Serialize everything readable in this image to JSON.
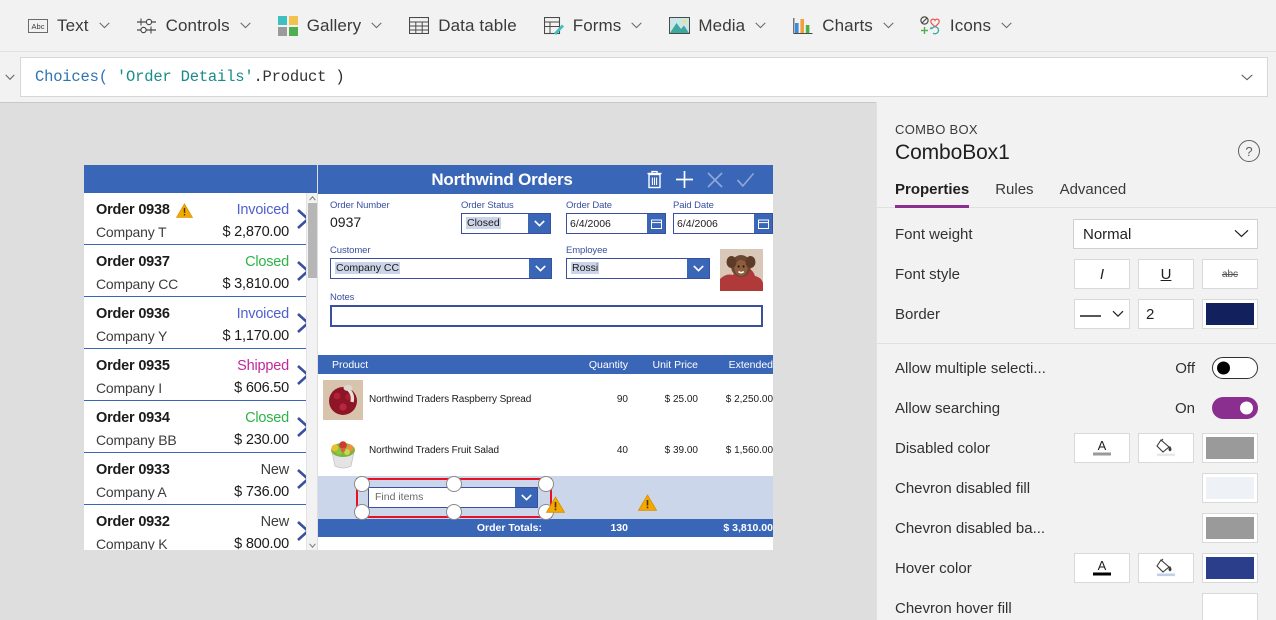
{
  "ribbon": {
    "items": [
      {
        "label": "Text",
        "icon": "text-abc-icon",
        "chevron": true
      },
      {
        "label": "Controls",
        "icon": "controls-sliders-icon",
        "chevron": true
      },
      {
        "label": "Gallery",
        "icon": "gallery-grid-icon",
        "chevron": true
      },
      {
        "label": "Data table",
        "icon": "data-table-icon",
        "chevron": false
      },
      {
        "label": "Forms",
        "icon": "forms-icon",
        "chevron": true
      },
      {
        "label": "Media",
        "icon": "media-image-icon",
        "chevron": true
      },
      {
        "label": "Charts",
        "icon": "charts-bar-icon",
        "chevron": true
      },
      {
        "label": "Icons",
        "icon": "icons-shapes-icon",
        "chevron": true
      }
    ]
  },
  "formula_bar": {
    "property_chevron": "chevron-down-icon",
    "tokens": {
      "fn": "Choices(",
      "str": " 'Order Details'",
      "prop": ".Product",
      "close": " )"
    },
    "full_text": "Choices( 'Order Details'.Product )",
    "expand_icon": "chevron-down-icon"
  },
  "app": {
    "gallery": {
      "rows": [
        {
          "order": "Order 0938",
          "company": "Company T",
          "status": "Invoiced",
          "status_color": "#4f5fd0",
          "amount": "$ 2,870.00",
          "warning": true
        },
        {
          "order": "Order 0937",
          "company": "Company CC",
          "status": "Closed",
          "status_color": "#2db34a",
          "amount": "$ 3,810.00",
          "warning": false
        },
        {
          "order": "Order 0936",
          "company": "Company Y",
          "status": "Invoiced",
          "status_color": "#4f5fd0",
          "amount": "$ 1,170.00",
          "warning": false
        },
        {
          "order": "Order 0935",
          "company": "Company I",
          "status": "Shipped",
          "status_color": "#c0289a",
          "amount": "$ 606.50",
          "warning": false
        },
        {
          "order": "Order 0934",
          "company": "Company BB",
          "status": "Closed",
          "status_color": "#2db34a",
          "amount": "$ 230.00",
          "warning": false
        },
        {
          "order": "Order 0933",
          "company": "Company A",
          "status": "New",
          "status_color": "#3d3d3d",
          "amount": "$ 736.00",
          "warning": false
        },
        {
          "order": "Order 0932",
          "company": "Company K",
          "status": "New",
          "status_color": "#3d3d3d",
          "amount": "$ 800.00",
          "warning": false
        }
      ]
    },
    "form": {
      "title": "Northwind Orders",
      "actions": [
        {
          "name": "delete-icon",
          "label": "Delete"
        },
        {
          "name": "add-icon",
          "label": "Add"
        },
        {
          "name": "cancel-icon",
          "label": "Cancel"
        },
        {
          "name": "save-icon",
          "label": "Save"
        }
      ],
      "fields": {
        "order_number_label": "Order Number",
        "order_number_value": "0937",
        "order_status_label": "Order Status",
        "order_status_value": "Closed",
        "order_date_label": "Order Date",
        "order_date_value": "6/4/2006",
        "paid_date_label": "Paid Date",
        "paid_date_value": "6/4/2006",
        "customer_label": "Customer",
        "customer_value": "Company CC",
        "employee_label": "Employee",
        "employee_value": "Rossi",
        "notes_label": "Notes",
        "notes_value": ""
      },
      "table": {
        "headers": {
          "product": "Product",
          "quantity": "Quantity",
          "unit_price": "Unit Price",
          "extended": "Extended"
        },
        "rows": [
          {
            "product": "Northwind Traders Raspberry Spread",
            "quantity": "90",
            "unit_price": "$ 25.00",
            "extended": "$ 2,250.00"
          },
          {
            "product": "Northwind Traders Fruit Salad",
            "quantity": "40",
            "unit_price": "$ 39.00",
            "extended": "$ 1,560.00"
          }
        ],
        "totals": {
          "label": "Order Totals:",
          "quantity": "130",
          "extended": "$ 3,810.00"
        }
      },
      "new_item_combobox": {
        "placeholder": "Find items",
        "selected": true
      }
    }
  },
  "properties_panel": {
    "kind": "COMBO BOX",
    "name": "ComboBox1",
    "help_icon": "question-mark-icon",
    "tabs": [
      {
        "label": "Properties",
        "active": true
      },
      {
        "label": "Rules",
        "active": false
      },
      {
        "label": "Advanced",
        "active": false
      }
    ],
    "rows": [
      {
        "label": "Font weight",
        "type": "dropdown",
        "value": "Normal"
      },
      {
        "label": "Font style",
        "type": "style-buttons",
        "buttons": [
          {
            "name": "italic-button",
            "glyph": "I"
          },
          {
            "name": "underline-button",
            "glyph": "U"
          },
          {
            "name": "strikethrough-button",
            "glyph": "abc"
          }
        ]
      },
      {
        "label": "Border",
        "type": "border",
        "style": "solid-line",
        "thickness": "2",
        "color": "#12215e"
      },
      {
        "label": "Allow multiple selecti...",
        "type": "toggle",
        "state": "Off",
        "on": false
      },
      {
        "label": "Allow searching",
        "type": "toggle",
        "state": "On",
        "on": true
      },
      {
        "label": "Disabled color",
        "type": "color-trio",
        "text_icon": "font-color-icon",
        "fill_icon": "fill-color-icon",
        "color": "#9a9a9a"
      },
      {
        "label": "Chevron disabled fill",
        "type": "color-only",
        "color": "#eef1f6"
      },
      {
        "label": "Chevron disabled ba...",
        "type": "color-only",
        "color": "#9a9a9a"
      },
      {
        "label": "Hover color",
        "type": "color-trio",
        "text_icon": "font-color-icon",
        "fill_icon": "fill-color-icon",
        "color": "#2b3e8c"
      },
      {
        "label": "Chevron hover fill",
        "type": "color-only",
        "color": "#ffffff"
      }
    ]
  },
  "colors": {
    "accent_purple": "#8a2f8f",
    "form_blue": "#3a66b7",
    "selection_red": "#e81123",
    "warning_amber": "#f5a800"
  }
}
